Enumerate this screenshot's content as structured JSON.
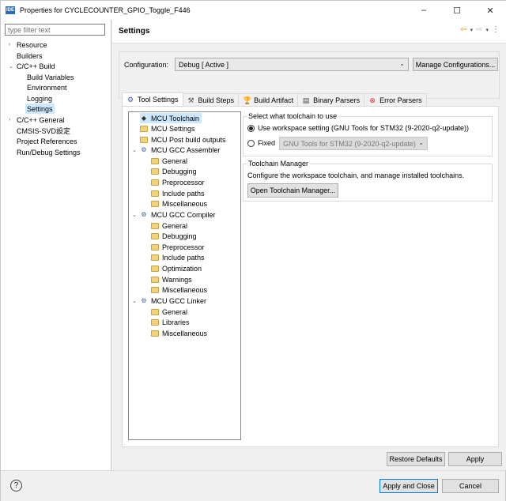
{
  "window": {
    "app_icon": "IDE",
    "title": "Properties for CYCLECOUNTER_GPIO_Toggle_F446",
    "controls": [
      "–",
      "☐",
      "✕"
    ]
  },
  "sidebar": {
    "filter_placeholder": "type filter text",
    "items": [
      {
        "label": "Resource",
        "arrow": "›",
        "level": 0
      },
      {
        "label": "Builders",
        "arrow": "",
        "level": 0
      },
      {
        "label": "C/C++ Build",
        "arrow": "⌄",
        "level": 0
      },
      {
        "label": "Build Variables",
        "arrow": "",
        "level": 1
      },
      {
        "label": "Environment",
        "arrow": "",
        "level": 1
      },
      {
        "label": "Logging",
        "arrow": "",
        "level": 1
      },
      {
        "label": "Settings",
        "arrow": "",
        "level": 1,
        "selected": true
      },
      {
        "label": "C/C++ General",
        "arrow": "›",
        "level": 0
      },
      {
        "label": "CMSIS-SVD設定",
        "arrow": "",
        "level": 0
      },
      {
        "label": "Project References",
        "arrow": "",
        "level": 0
      },
      {
        "label": "Run/Debug Settings",
        "arrow": "",
        "level": 0
      }
    ]
  },
  "header": {
    "title": "Settings",
    "nav_icons": [
      "back-icon",
      "forward-icon",
      "menu-icon"
    ],
    "nav_glyphs": [
      "⇦",
      "▾",
      "⇨",
      "▾",
      "⋮"
    ]
  },
  "configuration": {
    "label": "Configuration:",
    "value": "Debug  [ Active ]",
    "manage_button": "Manage Configurations..."
  },
  "tabs": [
    {
      "label": "Tool Settings",
      "icon": "gear-icon",
      "glyph": "⚙",
      "active": true
    },
    {
      "label": "Build Steps",
      "icon": "hammer-icon",
      "glyph": "⚒"
    },
    {
      "label": "Build Artifact",
      "icon": "trophy-icon",
      "glyph": "🏆"
    },
    {
      "label": "Binary Parsers",
      "icon": "binary-icon",
      "glyph": "▤"
    },
    {
      "label": "Error Parsers",
      "icon": "error-icon",
      "glyph": "⊗"
    }
  ],
  "tool_tree": [
    {
      "label": "MCU Toolchain",
      "icon": "toolchain-icon",
      "level": 0,
      "selected": true
    },
    {
      "label": "MCU Settings",
      "icon": "folder-icon",
      "level": 0
    },
    {
      "label": "MCU Post build outputs",
      "icon": "folder-icon",
      "level": 0
    },
    {
      "label": "MCU GCC Assembler",
      "icon": "gear-icon",
      "level": 0,
      "expanded": true
    },
    {
      "label": "General",
      "icon": "folder-icon",
      "level": 1
    },
    {
      "label": "Debugging",
      "icon": "folder-icon",
      "level": 1
    },
    {
      "label": "Preprocessor",
      "icon": "folder-icon",
      "level": 1
    },
    {
      "label": "Include paths",
      "icon": "folder-icon",
      "level": 1
    },
    {
      "label": "Miscellaneous",
      "icon": "folder-icon",
      "level": 1
    },
    {
      "label": "MCU GCC Compiler",
      "icon": "gear-icon",
      "level": 0,
      "expanded": true
    },
    {
      "label": "General",
      "icon": "folder-icon",
      "level": 1
    },
    {
      "label": "Debugging",
      "icon": "folder-icon",
      "level": 1
    },
    {
      "label": "Preprocessor",
      "icon": "folder-icon",
      "level": 1
    },
    {
      "label": "Include paths",
      "icon": "folder-icon",
      "level": 1
    },
    {
      "label": "Optimization",
      "icon": "folder-icon",
      "level": 1
    },
    {
      "label": "Warnings",
      "icon": "folder-icon",
      "level": 1
    },
    {
      "label": "Miscellaneous",
      "icon": "folder-icon",
      "level": 1
    },
    {
      "label": "MCU GCC Linker",
      "icon": "gear-icon",
      "level": 0,
      "expanded": true
    },
    {
      "label": "General",
      "icon": "folder-icon",
      "level": 1
    },
    {
      "label": "Libraries",
      "icon": "folder-icon",
      "level": 1
    },
    {
      "label": "Miscellaneous",
      "icon": "folder-icon",
      "level": 1
    }
  ],
  "toolchain_select": {
    "title": "Select what toolchain to use",
    "option_workspace": "Use workspace setting (GNU Tools for STM32 (9-2020-q2-update))",
    "option_fixed": "Fixed",
    "fixed_value": "GNU Tools for STM32 (9-2020-q2-update)",
    "selected": "workspace"
  },
  "toolchain_manager": {
    "title": "Toolchain Manager",
    "description": "Configure the workspace toolchain, and manage installed toolchains.",
    "button": "Open Toolchain Manager..."
  },
  "panel_buttons": {
    "restore": "Restore Defaults",
    "apply": "Apply"
  },
  "dialog_buttons": {
    "help": "?",
    "apply_close": "Apply and Close",
    "cancel": "Cancel"
  }
}
